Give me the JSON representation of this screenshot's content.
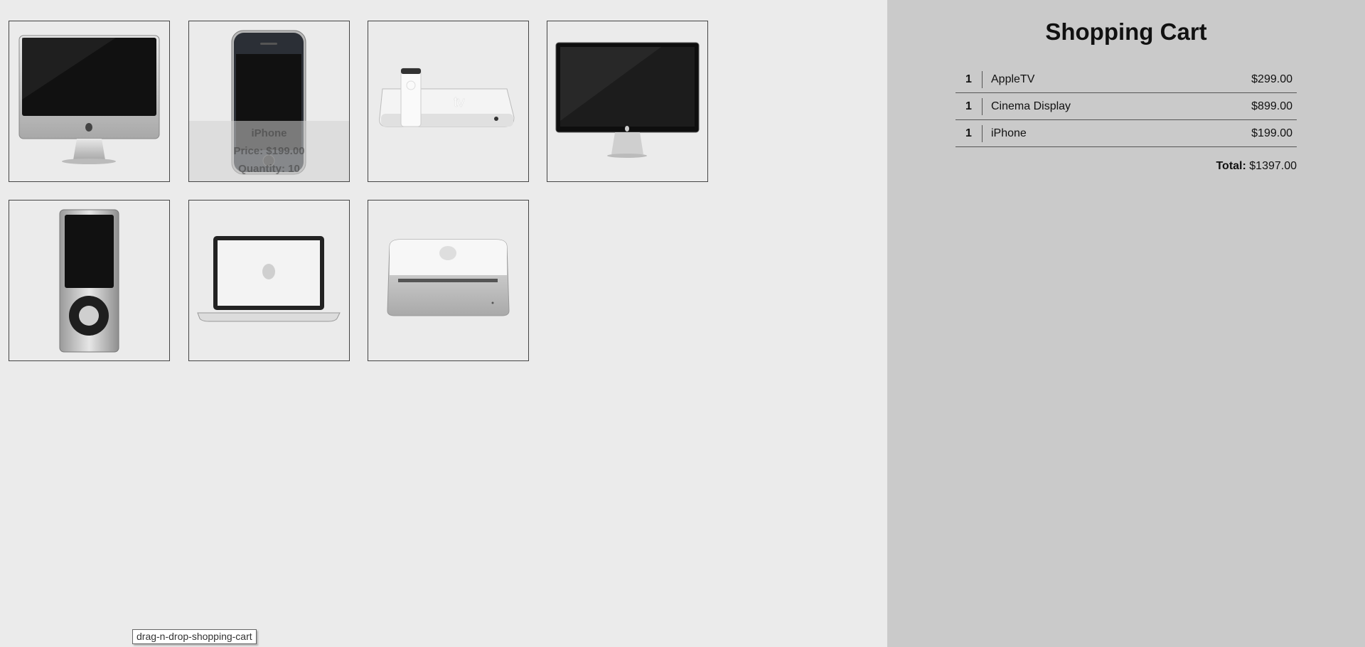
{
  "products": [
    {
      "name": "iMac",
      "icon": "imac-icon"
    },
    {
      "name": "iPhone",
      "icon": "iphone-icon",
      "overlay": {
        "title": "iPhone",
        "price_line": "Price: $199.00",
        "quantity_line": "Quantity: 10"
      }
    },
    {
      "name": "AppleTV",
      "icon": "appletv-icon"
    },
    {
      "name": "Cinema Display",
      "icon": "cinema-display-icon"
    },
    {
      "name": "iPod Nano",
      "icon": "ipod-icon"
    },
    {
      "name": "MacBook",
      "icon": "macbook-icon"
    },
    {
      "name": "Mac Mini",
      "icon": "mac-mini-icon"
    }
  ],
  "cart": {
    "title": "Shopping Cart",
    "items": [
      {
        "qty": "1",
        "name": "AppleTV",
        "price": "$299.00"
      },
      {
        "qty": "1",
        "name": "Cinema Display",
        "price": "$899.00"
      },
      {
        "qty": "1",
        "name": "iPhone",
        "price": "$199.00"
      }
    ],
    "total_label": "Total:",
    "total_value": "$1397.00"
  },
  "tooltip": "drag-n-drop-shopping-cart"
}
